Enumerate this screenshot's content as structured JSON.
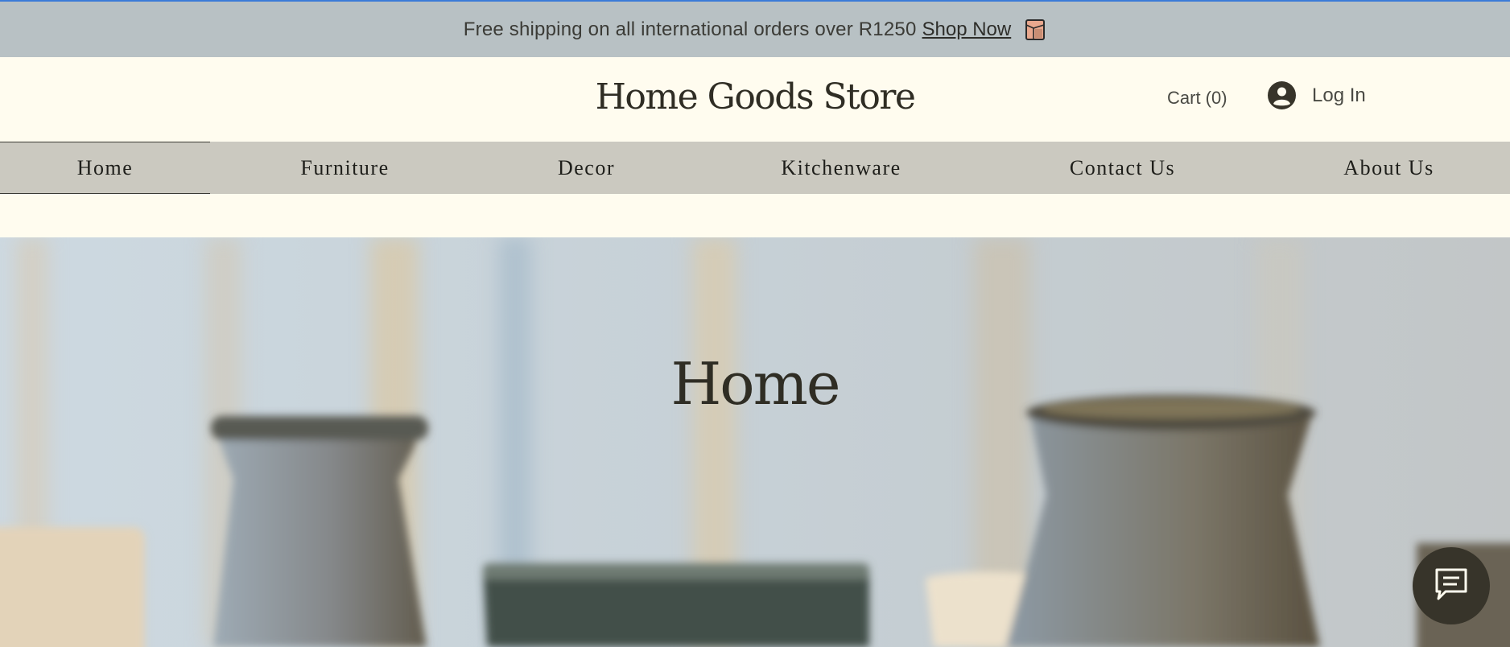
{
  "promo": {
    "text": "Free shipping on all international orders over R1250",
    "link": "Shop Now",
    "icon": "package-icon"
  },
  "header": {
    "logo": "Home Goods Store",
    "cart": "Cart (0)",
    "login": "Log In",
    "login_icon": "user-avatar-icon"
  },
  "nav": {
    "items": [
      {
        "label": "Home",
        "active": true
      },
      {
        "label": "Furniture"
      },
      {
        "label": "Decor"
      },
      {
        "label": "Kitchenware"
      },
      {
        "label": "Contact Us"
      },
      {
        "label": "About Us"
      }
    ]
  },
  "hero": {
    "title": "Home",
    "image": "blurred ceramic vases and candles"
  },
  "chat": {
    "icon": "chat-icon"
  },
  "colors": {
    "promo_bg": "#b8c1c4",
    "page_bg": "#fffcef",
    "nav_bg": "#cbc9c0",
    "text_dark": "#2f2d24",
    "chat_bg": "#37342a"
  }
}
